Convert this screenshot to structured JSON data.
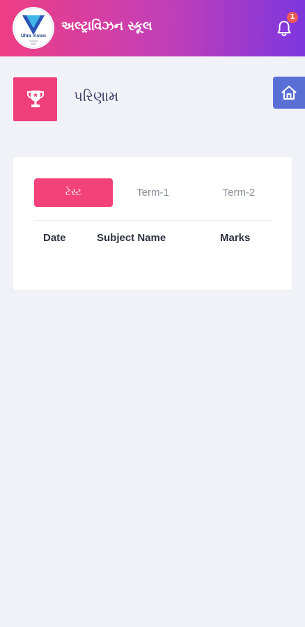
{
  "app": {
    "title": "અલ્ટ્રાવિઝન સ્કૂલ",
    "logo": {
      "text": "Ultra Vision",
      "icon": "school-logo"
    },
    "notifications": {
      "icon": "bell-icon",
      "count": "1"
    }
  },
  "page": {
    "icon": "trophy-icon",
    "title": "પરિણામ",
    "home_icon": "home-icon"
  },
  "results": {
    "tabs": [
      {
        "label": "ટેસ્ટ",
        "active": true
      },
      {
        "label": "Term-1",
        "active": false
      },
      {
        "label": "Term-2",
        "active": false
      }
    ],
    "columns": [
      "Date",
      "Subject Name",
      "Marks"
    ],
    "rows": []
  },
  "colors": {
    "gradient_start": "#ef3e84",
    "gradient_end": "#7d36de",
    "accent_pink": "#f24279",
    "home_blue": "#5a6fd6",
    "background": "#f1f2f8"
  }
}
